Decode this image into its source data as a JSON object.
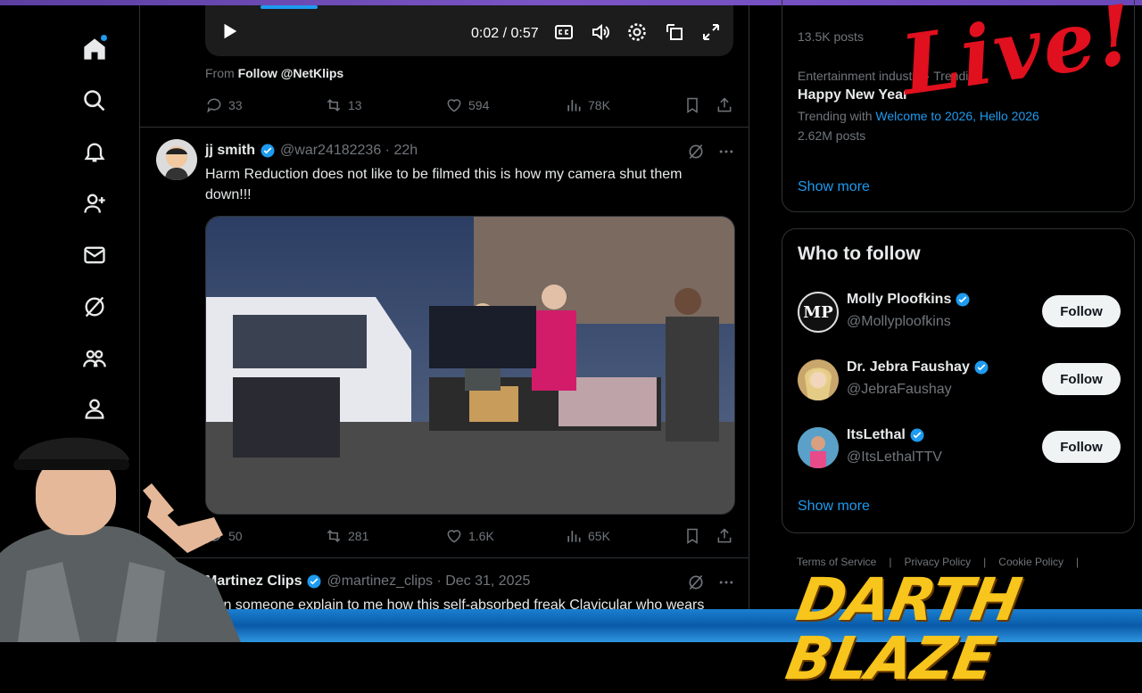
{
  "video_top": {
    "time": "0:02 / 0:57"
  },
  "prev_tweet": {
    "from_prefix": "From",
    "from_link": "Follow @NetKlips",
    "replies": "33",
    "retweets": "13",
    "likes": "594",
    "views": "78K"
  },
  "tweet1": {
    "name": "jj smith",
    "handle": "@war24182236 · 22h",
    "text": "Harm Reduction does not like to be filmed this is how my camera shut them down!!!",
    "replies": "50",
    "retweets": "281",
    "likes": "1.6K",
    "views": "65K"
  },
  "tweet2": {
    "name": "Martinez Clips",
    "handle": "@martinez_clips · Dec 31, 2025",
    "text": "Can someone explain to me how this self-absorbed freak Clavicular who wears"
  },
  "trends": {
    "first_count": "13.5K posts",
    "category": "Entertainment industry · Trending",
    "title": "Happy New Year",
    "trending_with_prefix": "Trending with",
    "trending_with_links": "Welcome to 2026, Hello 2026",
    "count": "2.62M posts",
    "show_more": "Show more"
  },
  "who_to_follow": {
    "title": "Who to follow",
    "follow_label": "Follow",
    "show_more": "Show more",
    "accounts": [
      {
        "name": "Molly Ploofkins",
        "handle": "@Mollyploofkins",
        "initials": "MP"
      },
      {
        "name": "Dr. Jebra Faushay",
        "handle": "@JebraFaushay"
      },
      {
        "name": "ItsLethal",
        "handle": "@ItsLethalTTV"
      }
    ]
  },
  "footer": {
    "links": [
      "Terms of Service",
      "|",
      "Privacy Policy",
      "|",
      "Cookie Policy",
      "|"
    ]
  },
  "overlay": {
    "live": "Live!",
    "brand": "DARTH BLAZE"
  },
  "colors": {
    "accent": "#1d9bf0",
    "background": "#000000",
    "live_red": "#e0101e",
    "brand_yellow": "#f7c51b"
  }
}
